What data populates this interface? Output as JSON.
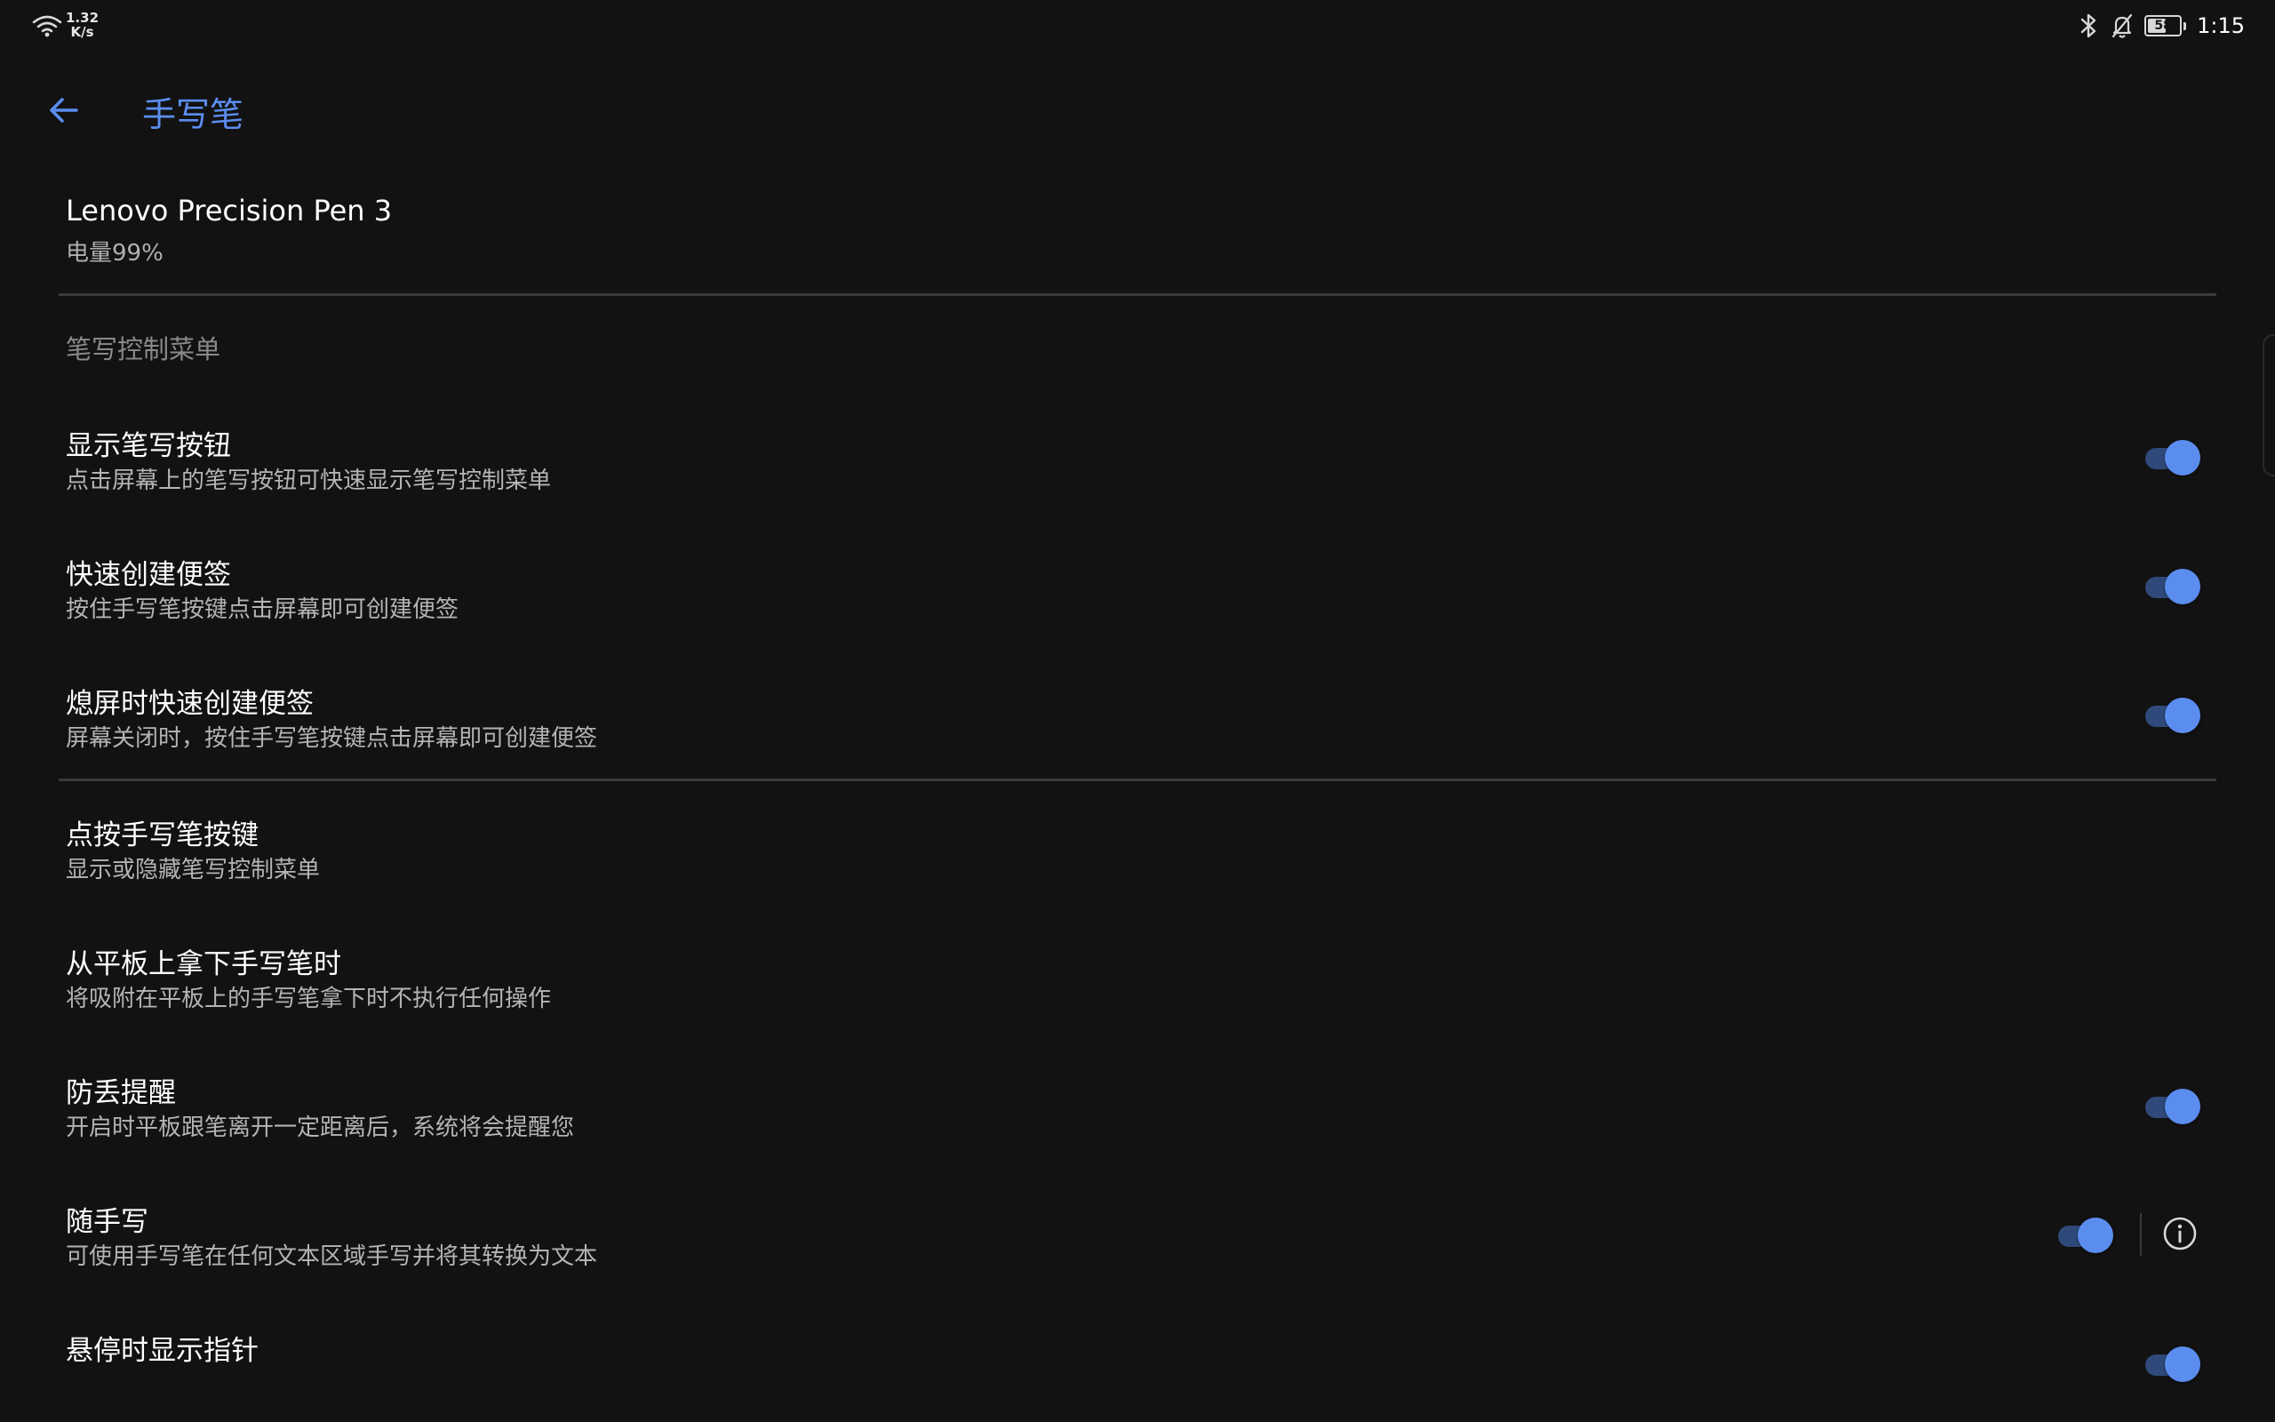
{
  "status_bar": {
    "net_speed_value": "1.32",
    "net_speed_unit": "K/s",
    "battery": "58",
    "battery_level": 58,
    "time": "1:15",
    "icons": [
      "wifi-icon",
      "bluetooth-icon",
      "bell-off-icon",
      "battery-icon"
    ]
  },
  "app_bar": {
    "title": "手写笔",
    "back_icon": "arrow-left-icon"
  },
  "device": {
    "name": "Lenovo Precision Pen 3",
    "battery_text": "电量99%"
  },
  "section_header": "笔写控制菜单",
  "settings": [
    {
      "title": "显示笔写按钮",
      "subtitle": "点击屏幕上的笔写按钮可快速显示笔写控制菜单",
      "toggle": true
    },
    {
      "title": "快速创建便签",
      "subtitle": "按住手写笔按键点击屏幕即可创建便签",
      "toggle": true
    },
    {
      "title": "熄屏时快速创建便签",
      "subtitle": "屏幕关闭时，按住手写笔按键点击屏幕即可创建便签",
      "toggle": true
    },
    {
      "title": "点按手写笔按键",
      "subtitle": "显示或隐藏笔写控制菜单"
    },
    {
      "title": "从平板上拿下手写笔时",
      "subtitle": "将吸附在平板上的手写笔拿下时不执行任何操作"
    },
    {
      "title": "防丢提醒",
      "subtitle": "开启时平板跟笔离开一定距离后，系统将会提醒您",
      "toggle": true
    },
    {
      "title": "随手写",
      "subtitle": "可使用手写笔在任何文本区域手写并将其转换为文本",
      "toggle": true,
      "info_icon": "info-icon"
    },
    {
      "title": "悬停时显示指针",
      "subtitle": "",
      "toggle": true
    }
  ],
  "colors": {
    "background": "#121212",
    "accent": "#5b8def",
    "toggle_track": "#2f4a7a",
    "divider": "#3a3a3a"
  }
}
